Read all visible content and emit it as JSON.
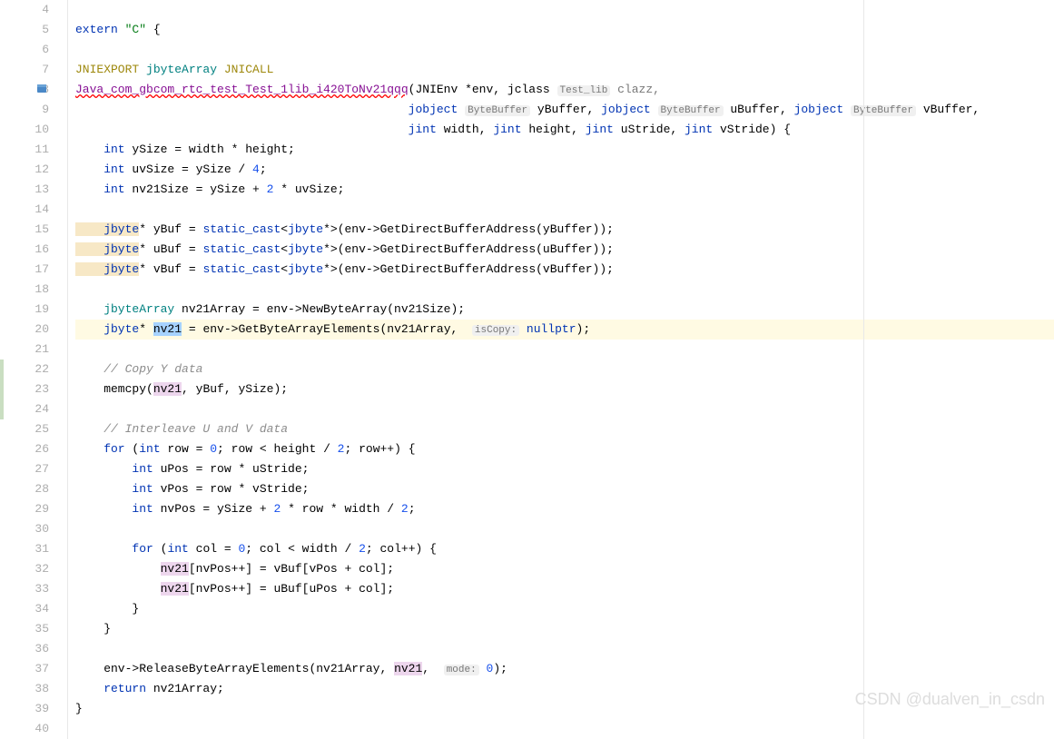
{
  "lines": {
    "4": "4",
    "5": "5",
    "6": "6",
    "7": "7",
    "8": "8",
    "9": "9",
    "10": "10",
    "11": "11",
    "12": "12",
    "13": "13",
    "14": "14",
    "15": "15",
    "16": "16",
    "17": "17",
    "18": "18",
    "19": "19",
    "20": "20",
    "21": "21",
    "22": "22",
    "23": "23",
    "24": "24",
    "25": "25",
    "26": "26",
    "27": "27",
    "28": "28",
    "29": "29",
    "30": "30",
    "31": "31",
    "32": "32",
    "33": "33",
    "34": "34",
    "35": "35",
    "36": "36",
    "37": "37",
    "38": "38",
    "39": "39",
    "40": "40"
  },
  "code": {
    "l5_extern": "extern",
    "l5_c": "\"C\"",
    "l5_brace": " {",
    "l7_jniexport": "JNIEXPORT ",
    "l7_jbytearray": "jbyteArray",
    "l7_jnicall": " JNICALL",
    "l8_fn": "Java_com_gbcom_rtc_test_Test_1lib_i420ToNv21qqq",
    "l8_paren": "(JNIEnv *env, jclass ",
    "l8_hint": "Test_lib",
    "l8_clazz": " clazz,",
    "l9_pad": "                                               ",
    "l9_jobj1": "jobject ",
    "l9_hint1": "ByteBuffer",
    "l9_ybuf": " yBuffer, ",
    "l9_jobj2": "jobject ",
    "l9_hint2": "ByteBuffer",
    "l9_ubuf": " uBuffer, ",
    "l9_jobj3": "jobject ",
    "l9_hint3": "ByteBuffer",
    "l9_vbuf": " vBuffer,",
    "l10_pad": "                                               ",
    "l10_jint1": "jint",
    "l10_w": " width, ",
    "l10_jint2": "jint",
    "l10_h": " height, ",
    "l10_jint3": "jint",
    "l10_us": " uStride, ",
    "l10_jint4": "jint",
    "l10_vs": " vStride) {",
    "l11_int": "    int",
    "l11_rest": " ySize = width * height;",
    "l12_int": "    int",
    "l12_rest": " uvSize = ySize / ",
    "l12_num": "4",
    "l12_semi": ";",
    "l13_int": "    int",
    "l13_r1": " nv21Size = ySize + ",
    "l13_num": "2",
    "l13_r2": " * uvSize;",
    "l15_jbyte": "    jbyte",
    "l15_r1": "* yBuf = ",
    "l15_cast": "static_cast",
    "l15_r2": "<",
    "l15_jbyte2": "jbyte",
    "l15_r3": "*>(env->GetDirectBufferAddress(yBuffer));",
    "l16_jbyte": "    jbyte",
    "l16_r1": "* uBuf = ",
    "l16_cast": "static_cast",
    "l16_r2": "<",
    "l16_jbyte2": "jbyte",
    "l16_r3": "*>(env->GetDirectBufferAddress(uBuffer));",
    "l17_jbyte": "    jbyte",
    "l17_r1": "* vBuf = ",
    "l17_cast": "static_cast",
    "l17_r2": "<",
    "l17_jbyte2": "jbyte",
    "l17_r3": "*>(env->GetDirectBufferAddress(vBuffer));",
    "l19_type": "    jbyteArray",
    "l19_rest": " nv21Array = env->NewByteArray(nv21Size);",
    "l20_jbyte": "    jbyte",
    "l20_r1": "* ",
    "l20_nv21": "nv21",
    "l20_r2": " = env->GetByteArrayElements(nv21Array,  ",
    "l20_hint": "isCopy:",
    "l20_null": " nullptr",
    "l20_r3": ");",
    "l22_cmt": "    // Copy Y data",
    "l23_r1": "    memcpy(",
    "l23_nv21": "nv21",
    "l23_r2": ", yBuf, ySize);",
    "l25_cmt": "    // Interleave U and V data",
    "l26_for": "    for",
    "l26_r1": " (",
    "l26_int": "int",
    "l26_r2": " row = ",
    "l26_n1": "0",
    "l26_r3": "; row < height / ",
    "l26_n2": "2",
    "l26_r4": "; row++) {",
    "l27_int": "        int",
    "l27_rest": " uPos = row * uStride;",
    "l28_int": "        int",
    "l28_rest": " vPos = row * vStride;",
    "l29_int": "        int",
    "l29_r1": " nvPos = ySize + ",
    "l29_n1": "2",
    "l29_r2": " * row * width / ",
    "l29_n2": "2",
    "l29_r3": ";",
    "l31_for": "        for",
    "l31_r1": " (",
    "l31_int": "int",
    "l31_r2": " col = ",
    "l31_n1": "0",
    "l31_r3": "; col < width / ",
    "l31_n2": "2",
    "l31_r4": "; col++) {",
    "l32_pad": "            ",
    "l32_nv21": "nv21",
    "l32_rest": "[nvPos++] = vBuf[vPos + col];",
    "l33_pad": "            ",
    "l33_nv21": "nv21",
    "l33_rest": "[nvPos++] = uBuf[uPos + col];",
    "l34": "        }",
    "l35": "    }",
    "l37_r1": "    env->ReleaseByteArrayElements(nv21Array, ",
    "l37_nv21": "nv21",
    "l37_r2": ",  ",
    "l37_hint": "mode:",
    "l37_n": " 0",
    "l37_r3": ");",
    "l38_ret": "    return",
    "l38_rest": " nv21Array;",
    "l39": "}"
  },
  "watermark": "CSDN @dualven_in_csdn"
}
